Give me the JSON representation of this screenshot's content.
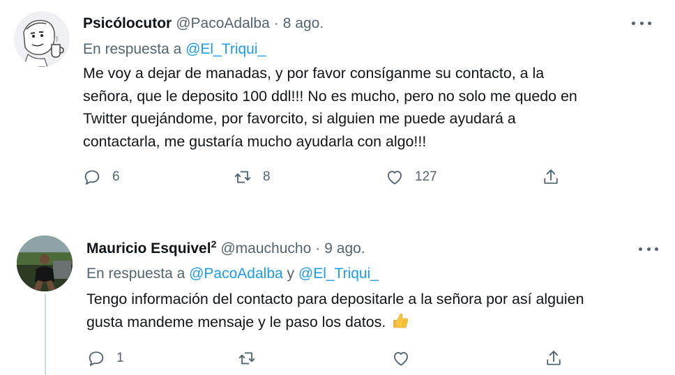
{
  "tweets": [
    {
      "author_name": "Psicólocutor",
      "author_badge": "",
      "handle": "@PacoAdalba",
      "separator": "·",
      "date": "8 ago.",
      "reply_prefix": "En respuesta a",
      "reply_mentions": [
        "@El_Triqui_"
      ],
      "reply_joiner": "",
      "body": "Me voy a dejar de manadas, y por favor consíganme su contacto, a la\nseñora, que le deposito 100 ddl!!! No es mucho, pero no solo me quedo en\nTwitter quejándome, por favorcito, si alguien me puede ayudará a\ncontactarla, me gustaría mucho ayudarla con algo!!!",
      "actions": {
        "replies": "6",
        "retweets": "8",
        "likes": "127"
      }
    },
    {
      "author_name": "Mauricio Esquivel",
      "author_badge": "2",
      "handle": "@mauchucho",
      "separator": "·",
      "date": "9 ago.",
      "reply_prefix": "En respuesta a",
      "reply_mentions": [
        "@PacoAdalba",
        "@El_Triqui_"
      ],
      "reply_joiner": "y",
      "body": "Tengo información del contacto para depositarle a la señora por así alguien\ngusta mandeme mensaje y le paso los datos.",
      "actions": {
        "replies": "1",
        "retweets": "",
        "likes": ""
      }
    }
  ],
  "icons": {
    "more": "more-horizontal-icon",
    "reply": "reply-icon",
    "retweet": "retweet-icon",
    "like": "heart-icon",
    "share": "share-icon",
    "emoji": "thumbs-up-emoji-icon"
  },
  "colors": {
    "text": "#0f1419",
    "secondary": "#536471",
    "link": "#1d9bf0",
    "thread_line": "#cfd9de"
  }
}
